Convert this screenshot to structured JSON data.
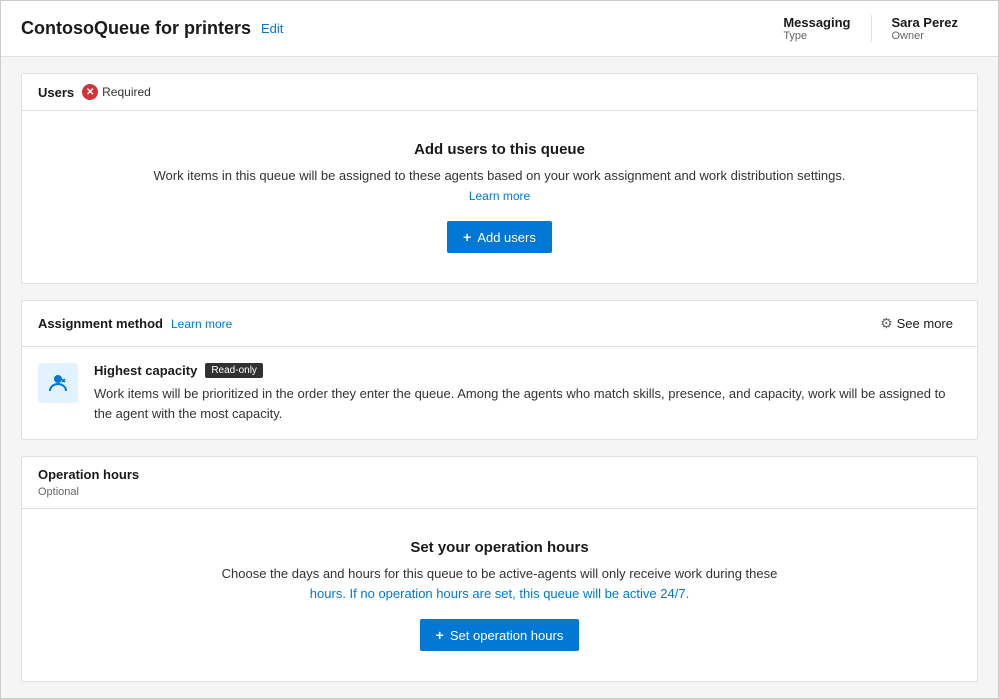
{
  "header": {
    "title": "ContosoQueue for printers",
    "edit_label": "Edit",
    "meta": [
      {
        "label": "Type",
        "value": "Messaging"
      },
      {
        "label": "Owner",
        "value": "Sara Perez"
      }
    ]
  },
  "users_section": {
    "title": "Users",
    "required_text": "Required",
    "body_title": "Add users to this queue",
    "body_desc": "Work items in this queue will be assigned to these agents based on your work assignment and work distribution settings.",
    "learn_more_label": "Learn more",
    "add_button_label": "+ Add users"
  },
  "assignment_section": {
    "title": "Assignment method",
    "learn_more_label": "Learn more",
    "see_more_label": "See more",
    "method_title": "Highest capacity",
    "read_only_badge": "Read-only",
    "method_desc": "Work items will be prioritized in the order they enter the queue. Among the agents who match skills, presence, and capacity, work will be assigned to the agent with the most capacity."
  },
  "operation_section": {
    "title": "Operation hours",
    "optional_text": "Optional",
    "body_title": "Set your operation hours",
    "body_desc_plain": "Choose the days and hours for this queue to be active-agents will only receive work during these",
    "body_desc_highlight": "hours. If no operation hours are set, this queue will be active 24/7.",
    "set_button_label": "+ Set operation hours"
  }
}
